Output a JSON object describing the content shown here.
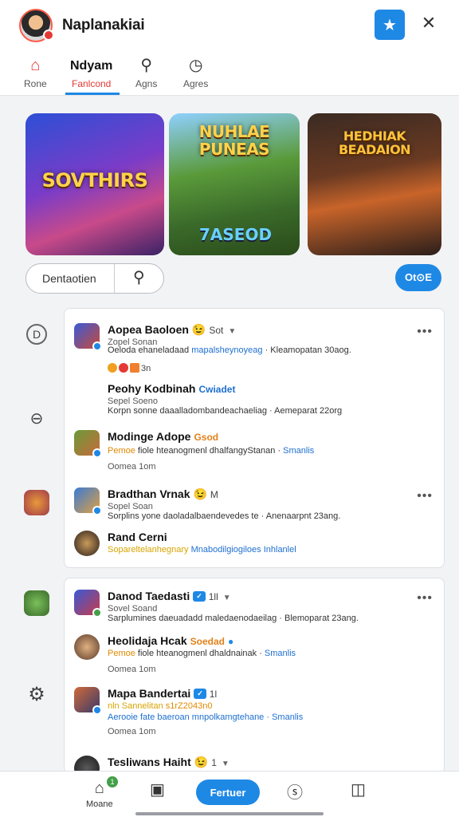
{
  "header": {
    "title": "Naplanakiai",
    "star_icon": "★",
    "close_icon": "✕"
  },
  "tabs": [
    {
      "label": "Rone",
      "icon": "home-icon",
      "glyph": "⌂"
    },
    {
      "label": "Fanlcond",
      "heading": "Ndyam",
      "active": true
    },
    {
      "label": "Agns",
      "icon": "search-icon",
      "glyph": "⚲"
    },
    {
      "label": "Agres",
      "icon": "clock-icon",
      "glyph": "◷"
    }
  ],
  "banner": {
    "games": [
      {
        "title": "SOVTHIRS"
      },
      {
        "title": "NUHLAE PUNEAS",
        "subtitle": "7ASEOD"
      },
      {
        "title": "HEDHIAK BEADAION"
      }
    ]
  },
  "search": {
    "label": "Dentaotien",
    "icon_glyph": "⚲"
  },
  "go_button": {
    "label": "Ot⊙E"
  },
  "rail": {
    "glyph_1": "D",
    "glyph_2": "⊖",
    "glyph_3": "⚙"
  },
  "feed": {
    "card1": {
      "posts": [
        {
          "name": "Aopea Baoloen",
          "emoji": "😉",
          "tag": "Sot",
          "sub": "Zopel Sonan",
          "line_dark": "Oeloda ehaneladaad ",
          "line_blue": "mapalsheynoyeag",
          "line_rest": " · Kleamopatan 30aog.",
          "meta": "3n"
        },
        {
          "name": "Peohy Kodbinah",
          "name_blue": "Cwiadet",
          "sub": "Sepel Soeno",
          "line": "Korpn sonne daaalladombandeachaeliag · Aemeparat 22org"
        },
        {
          "name": "Modinge Adope",
          "tag": "Gsod",
          "line_orange": "Pemoe",
          "line_dark": " fiole hteanogmenl dhalfangyStanan · ",
          "line_blue": "Smanlis",
          "sub": "Oomea  1om"
        },
        {
          "name": "Bradthan Vrnak",
          "emoji": "😉",
          "tag": "M",
          "sub": "Sopel Soan",
          "line": "Sorplins yone daoladalbaendevedes te · Anenaarpnt 23ang."
        },
        {
          "name": "Rand Cerni",
          "line_yellow": "Sopareltelanhegnary",
          "line_blue": "Mnabodilgiogiloes Inhlanlel"
        }
      ]
    },
    "card2": {
      "posts": [
        {
          "name": "Danod Taedasti",
          "badge": "✓",
          "tag": "1ll",
          "sub": "Sovel Soand",
          "line": "Sarplumines daeuadadd maledaenodaeilag · Blemoparat 23ang."
        },
        {
          "name": "Heolidaja Hcak",
          "tag": "Soedad",
          "line_orange": "Pemoe",
          "line_dark": " fiole hteanogmenl dhaldnainak · ",
          "line_blue": "Smanlis",
          "sub": "Oomea  1om"
        },
        {
          "name": "Mapa Bandertai",
          "badge": "✓",
          "tag": "1l",
          "line_yellow": "nln Sannelitan ",
          "line_orange": "s1rZ2043n0",
          "line_blue": "Aerooie fate baeroan mnpolkamgtehane · Smanlis",
          "sub": "Oomea  1om"
        },
        {
          "name": "Tesliwans Haiht",
          "emoji": "😉",
          "tag": "1"
        }
      ]
    }
  },
  "more_glyph": "•••",
  "bottom_nav": {
    "home_label": "Moane",
    "home_badge": "1",
    "feature_label": "Fertuer"
  }
}
